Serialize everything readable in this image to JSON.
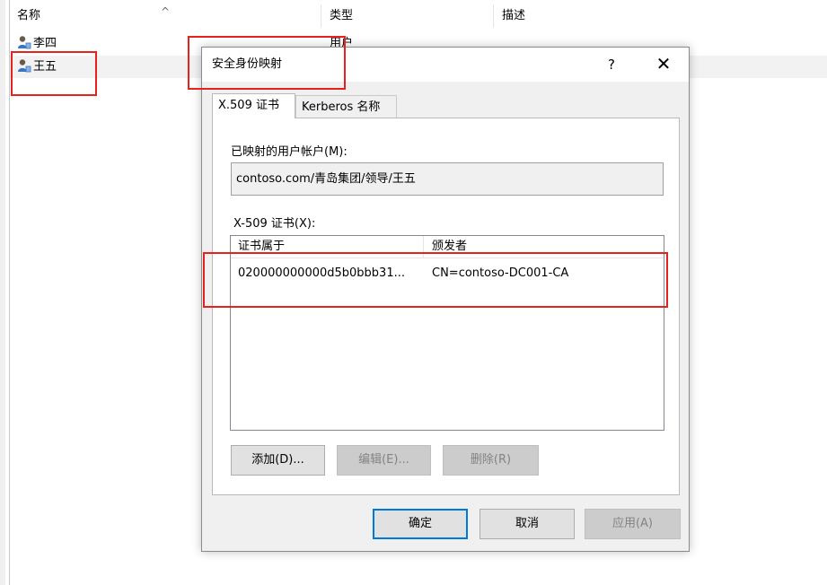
{
  "list": {
    "columns": [
      "名称",
      "类型",
      "描述"
    ],
    "sort_indicator": "^",
    "rows": [
      {
        "name": "李四",
        "type": "用户"
      },
      {
        "name": "王五",
        "type": ""
      }
    ]
  },
  "dialog": {
    "title": "安全身份映射",
    "help": "?",
    "close": "✕",
    "tabs": [
      "X.509 证书",
      "Kerberos 名称"
    ],
    "mapped_account_label": "已映射的用户帐户(M):",
    "mapped_account_value": "contoso.com/青岛集团/领导/王五",
    "cert_label": "X-509 证书(X):",
    "cert_columns": [
      "证书属于",
      "颁发者"
    ],
    "cert_rows": [
      {
        "owner": "020000000000d5b0bbb31...",
        "issuer": "CN=contoso-DC001-CA"
      }
    ],
    "buttons": {
      "add": "添加(D)...",
      "edit": "编辑(E)...",
      "delete": "删除(R)",
      "ok": "确定",
      "cancel": "取消",
      "apply": "应用(A)"
    }
  },
  "colors": {
    "highlight_box": "#e8211a",
    "dialog_bg": "#f0f0f0",
    "default_button_border": "#0078d7"
  }
}
